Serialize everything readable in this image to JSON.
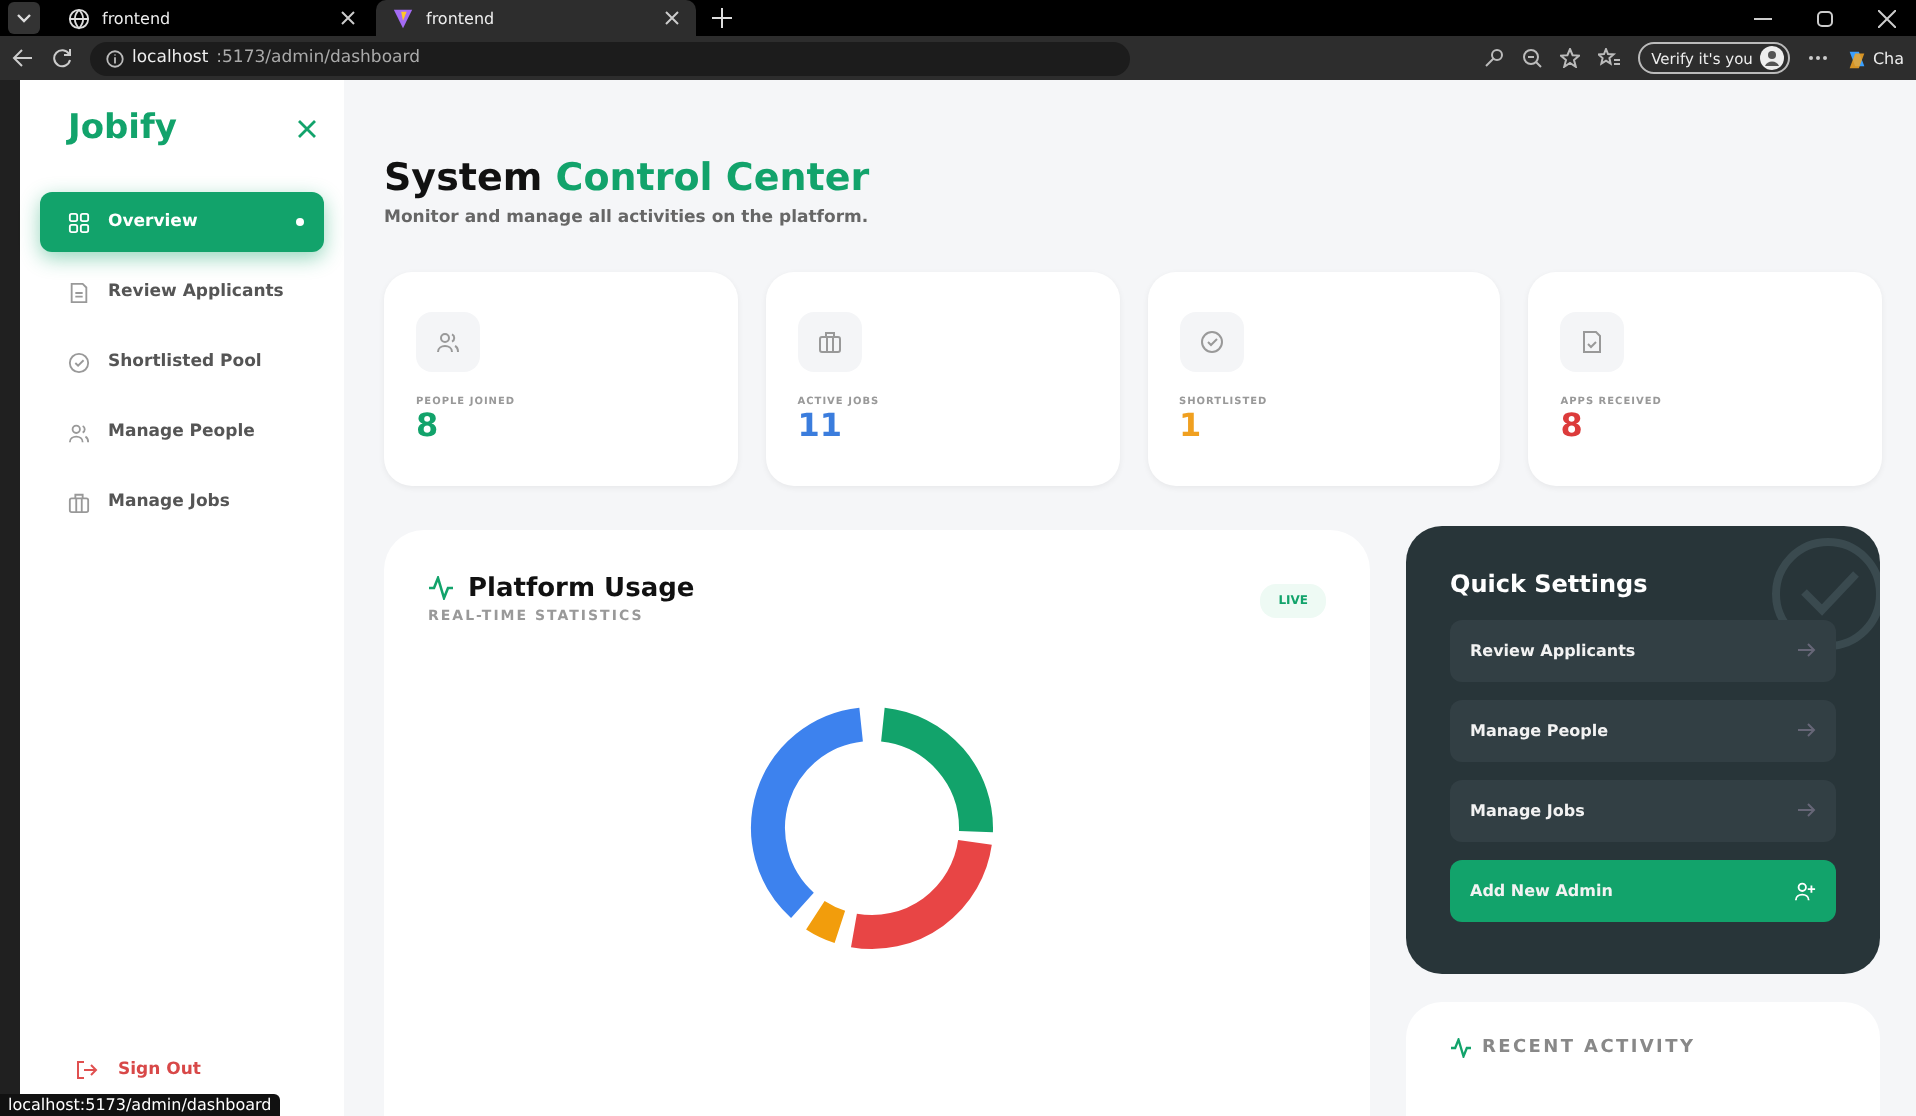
{
  "browser": {
    "tabs": [
      {
        "label": "frontend",
        "selected": false
      },
      {
        "label": "frontend",
        "selected": true
      }
    ],
    "url_host": "localhost",
    "url_path": ":5173/admin/dashboard",
    "verify_button": "Verify it's you",
    "profile_cut": "Cha"
  },
  "sidebar": {
    "logo": "Jobify",
    "items": [
      {
        "label": "Overview",
        "selected": true
      },
      {
        "label": "Review Applicants",
        "selected": false
      },
      {
        "label": "Shortlisted Pool",
        "selected": false
      },
      {
        "label": "Manage People",
        "selected": false
      },
      {
        "label": "Manage Jobs",
        "selected": false
      }
    ],
    "sign_out": "Sign Out"
  },
  "header": {
    "title_lead": "System",
    "title_accent": "Control Center",
    "subtitle": "Monitor and manage all activities on the platform."
  },
  "stats": [
    {
      "label": "PEOPLE JOINED",
      "value": "8",
      "color": "#12a36b"
    },
    {
      "label": "ACTIVE JOBS",
      "value": "11",
      "color": "#3b7ddd"
    },
    {
      "label": "SHORTLISTED",
      "value": "1",
      "color": "#f0a020"
    },
    {
      "label": "APPS RECEIVED",
      "value": "8",
      "color": "#dc3b3b"
    }
  ],
  "usage": {
    "title": "Platform Usage",
    "subtitle": "REAL-TIME STATISTICS",
    "badge": "LIVE"
  },
  "quick_settings": {
    "title": "Quick Settings",
    "items": [
      {
        "label": "Review Applicants",
        "kind": "link"
      },
      {
        "label": "Manage People",
        "kind": "link"
      },
      {
        "label": "Manage Jobs",
        "kind": "link"
      },
      {
        "label": "Add New Admin",
        "kind": "primary"
      }
    ]
  },
  "recent_activity": {
    "title": "RECENT ACTIVITY"
  },
  "status_bar": {
    "url": "localhost:5173/admin/dashboard"
  }
}
